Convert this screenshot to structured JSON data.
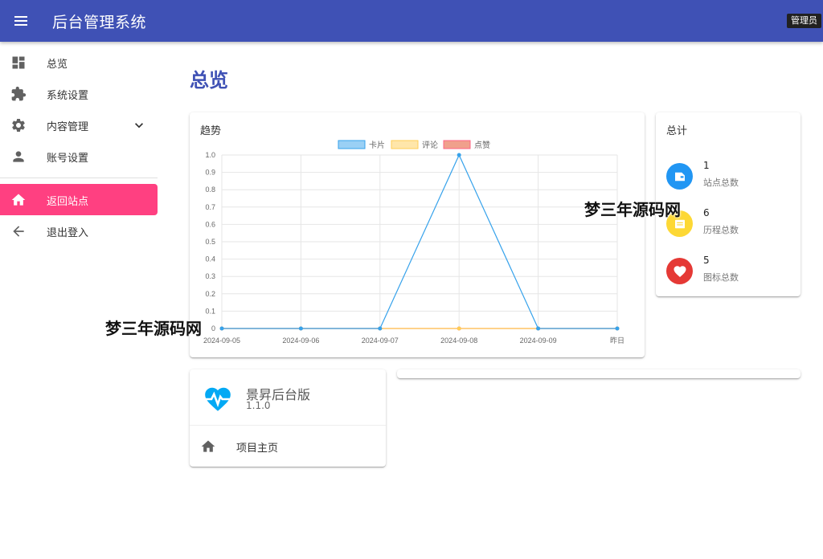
{
  "header": {
    "title": "后台管理系统",
    "user_role": "管理员"
  },
  "sidebar": {
    "items": [
      {
        "label": "总览",
        "icon": "dashboard-icon"
      },
      {
        "label": "系统设置",
        "icon": "extension-icon"
      },
      {
        "label": "内容管理",
        "icon": "gear-icon"
      },
      {
        "label": "账号设置",
        "icon": "person-icon"
      },
      {
        "label": "返回站点",
        "icon": "home-icon"
      },
      {
        "label": "退出登入",
        "icon": "arrow-left-icon"
      }
    ],
    "active_item": "返回站点"
  },
  "main": {
    "page_title": "总览",
    "trend_card": {
      "title": "趋势"
    },
    "total_card": {
      "title": "总计",
      "stats": [
        {
          "value": "1",
          "label": "站点总数",
          "icon": "site-icon",
          "color": "#2196f3"
        },
        {
          "value": "6",
          "label": "历程总数",
          "icon": "history-icon",
          "color": "#fdd835"
        },
        {
          "value": "5",
          "label": "图标总数",
          "icon": "heart-icon",
          "color": "#e53935"
        }
      ]
    },
    "project_card": {
      "name": "景昇后台版",
      "version": "1.1.0",
      "link_label": "项目主页",
      "logo_icon": "heartbeat-icon",
      "logo_color": "#03a9f4"
    }
  },
  "watermarks": [
    "梦三年源码网",
    "梦三年源码网"
  ],
  "colors": {
    "primary": "#3f51b5",
    "accent": "#ff4081"
  },
  "chart_data": {
    "type": "line",
    "categories": [
      "2024-09-05",
      "2024-09-06",
      "2024-09-07",
      "2024-09-08",
      "2024-09-09",
      "昨日"
    ],
    "series": [
      {
        "name": "卡片",
        "values": [
          0,
          0,
          0,
          1,
          0,
          0
        ],
        "color": "#36a2eb",
        "fill": "#9ad0f5"
      },
      {
        "name": "评论",
        "values": [
          0,
          0,
          0,
          0,
          0,
          0
        ],
        "color": "#ffcd56",
        "fill": "#ffe6aa"
      },
      {
        "name": "点赞",
        "values": [
          0,
          0,
          0,
          0,
          0,
          0
        ],
        "color": "#ff6384",
        "fill": "#f0a08c"
      }
    ],
    "ylim": [
      0,
      1
    ],
    "yticks": [
      "0",
      "0.1",
      "0.2",
      "0.3",
      "0.4",
      "0.5",
      "0.6",
      "0.7",
      "0.8",
      "0.9",
      "1.0"
    ],
    "grid": true,
    "legend": "top-center",
    "title": "",
    "xlabel": "",
    "ylabel": ""
  }
}
